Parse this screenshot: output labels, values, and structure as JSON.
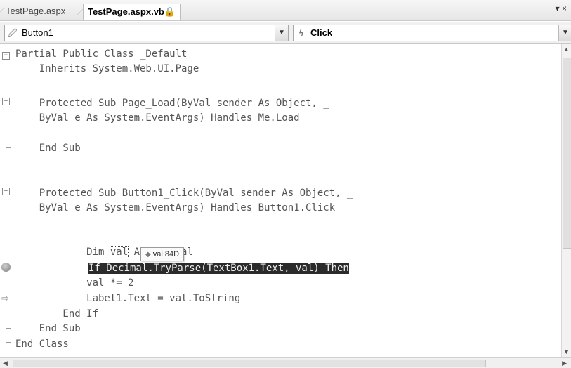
{
  "tabs": [
    {
      "label": "TestPage.aspx",
      "active": false
    },
    {
      "label": "TestPage.aspx.vb🔒",
      "active": true
    }
  ],
  "tab_controls": "▾ ×",
  "nav": {
    "class_combo": "Button1",
    "class_icon": "component-icon",
    "method_combo": "Click",
    "method_icon": "event-lightning-icon"
  },
  "code": {
    "l1": "Partial Public Class _Default",
    "l2": "    Inherits System.Web.UI.Page",
    "l3": "    Protected Sub Page_Load(ByVal sender As Object, _",
    "l4": "    ByVal e As System.EventArgs) Handles Me.Load",
    "l5": "    End Sub",
    "l6": "    Protected Sub Button1_Click(ByVal sender As Object, _",
    "l7": "    ByVal e As System.EventArgs) Handles Button1.Click",
    "l8_pre": "        Dim ",
    "l8_var": "val",
    "l8_post": " As Decimal",
    "l9": "If Decimal.TryParse(TextBox1.Text, val) Then",
    "l10": "            val *= 2",
    "l11": "            Label1.Text = val.ToString",
    "l12": "        End If",
    "l13": "    End Sub",
    "l14": "End Class"
  },
  "datatip": {
    "icon": "variable-icon",
    "text": "val 84D"
  },
  "colors": {
    "highlight_bg": "#2b2b2b",
    "highlight_fg": "#eeeeee"
  }
}
